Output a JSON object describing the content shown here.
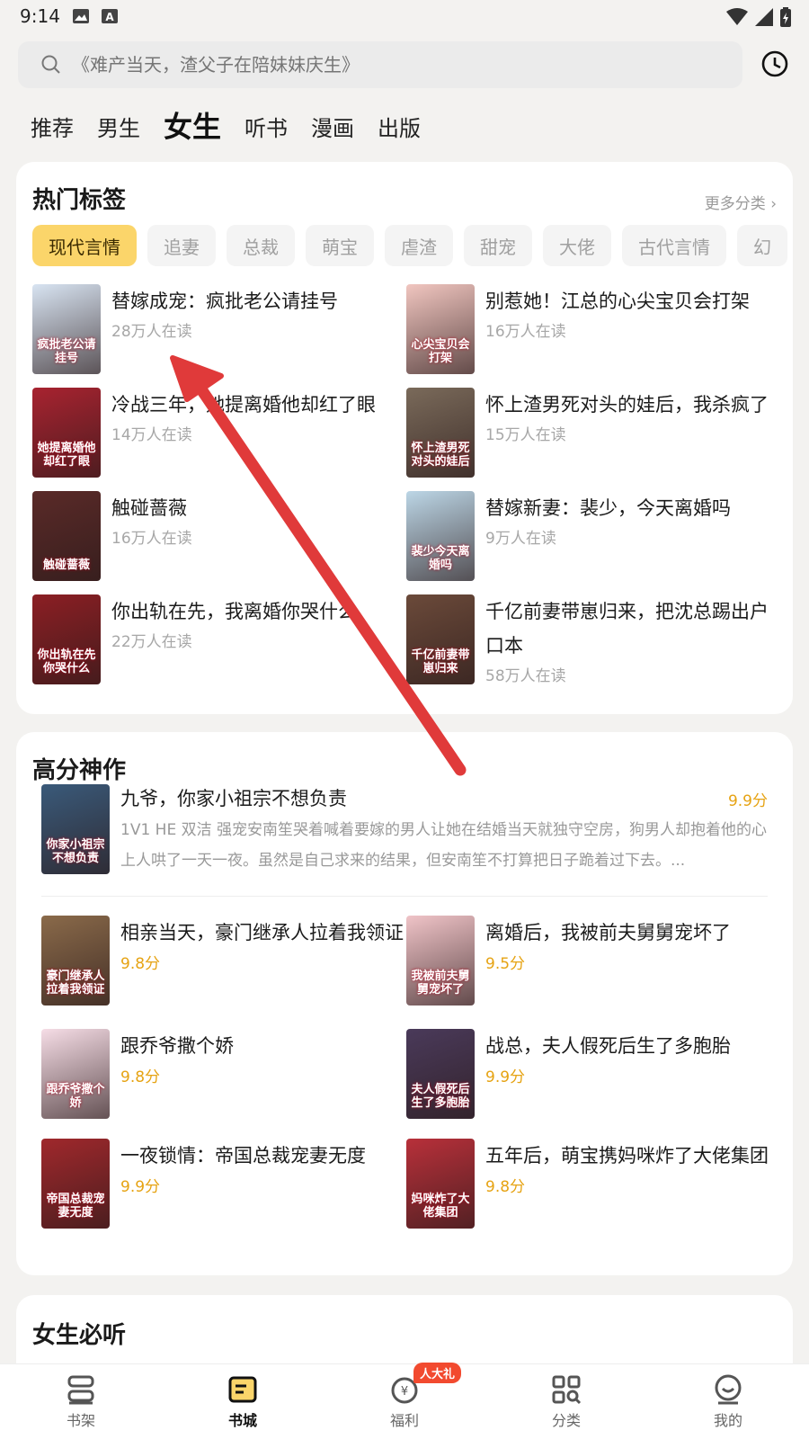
{
  "status": {
    "time": "9:14"
  },
  "search": {
    "placeholder": "《难产当天，渣父子在陪妹妹庆生》"
  },
  "channels": [
    "推荐",
    "男生",
    "女生",
    "听书",
    "漫画",
    "出版"
  ],
  "hot": {
    "title": "热门标签",
    "more": "更多分类",
    "tags": [
      "现代言情",
      "追妻",
      "总裁",
      "萌宝",
      "虐渣",
      "甜宠",
      "大佬",
      "古代言情",
      "幻"
    ],
    "books": [
      {
        "title": "替嫁成宠：疯批老公请挂号",
        "readers": "28万人在读",
        "cover_text": "疯批老公请挂号",
        "color": "#d8e4f2"
      },
      {
        "title": "别惹她！江总的心尖宝贝会打架",
        "readers": "16万人在读",
        "cover_text": "心尖宝贝会打架",
        "color": "#f1c6c0"
      },
      {
        "title": "冷战三年，她提离婚他却红了眼",
        "readers": "14万人在读",
        "cover_text": "她提离婚他却红了眼",
        "color": "#a82330"
      },
      {
        "title": "怀上渣男死对头的娃后，我杀疯了",
        "readers": "15万人在读",
        "cover_text": "怀上渣男死对头的娃后",
        "color": "#7a6a5a"
      },
      {
        "title": "触碰蔷薇",
        "readers": "16万人在读",
        "cover_text": "触碰蔷薇",
        "color": "#5a2a28"
      },
      {
        "title": "替嫁新妻：裴少，今天离婚吗",
        "readers": "9万人在读",
        "cover_text": "裴少今天离婚吗",
        "color": "#bcd6e6"
      },
      {
        "title": "你出轨在先，我离婚你哭什么",
        "readers": "22万人在读",
        "cover_text": "你出轨在先你哭什么",
        "color": "#8c1f24"
      },
      {
        "title": "千亿前妻带崽归来，把沈总踢出户口本",
        "readers": "58万人在读",
        "cover_text": "千亿前妻带崽归来",
        "color": "#6b4a3a"
      }
    ]
  },
  "score": {
    "title": "高分神作",
    "featured": {
      "title": "九爷，你家小祖宗不想负责",
      "score": "9.9分",
      "desc": "1V1 HE 双洁 强宠安南笙哭着喊着要嫁的男人让她在结婚当天就独守空房，狗男人却抱着他的心上人哄了一天一夜。虽然是自己求来的结果，但安南笙不打算把日子跪着过下去。...",
      "cover_text": "你家小祖宗不想负责",
      "color": "#3a5a7a"
    },
    "books": [
      {
        "title": "相亲当天，豪门继承人拉着我领证",
        "score": "9.8分",
        "cover_text": "豪门继承人拉着我领证",
        "color": "#8a6a4a"
      },
      {
        "title": "离婚后，我被前夫舅舅宠坏了",
        "score": "9.5分",
        "cover_text": "我被前夫舅舅宠坏了",
        "color": "#f0c4c8"
      },
      {
        "title": "跟乔爷撒个娇",
        "score": "9.8分",
        "cover_text": "跟乔爷撒个娇",
        "color": "#f6dde6"
      },
      {
        "title": "战总，夫人假死后生了多胞胎",
        "score": "9.9分",
        "cover_text": "夫人假死后生了多胞胎",
        "color": "#4a3a5a"
      },
      {
        "title": "一夜锁情：帝国总裁宠妻无度",
        "score": "9.9分",
        "cover_text": "帝国总裁宠妻无度",
        "color": "#a0282c"
      },
      {
        "title": "五年后，萌宝携妈咪炸了大佬集团",
        "score": "9.8分",
        "cover_text": "妈咪炸了大佬集团",
        "color": "#b8303a"
      }
    ]
  },
  "listen": {
    "title": "女生必听"
  },
  "nav": {
    "items": [
      "书架",
      "书城",
      "福利",
      "分类",
      "我的"
    ],
    "badge": "人大礼"
  },
  "colors": {
    "accent": "#fbd56a",
    "score": "#e6a313",
    "arrow": "#e03a3a"
  }
}
